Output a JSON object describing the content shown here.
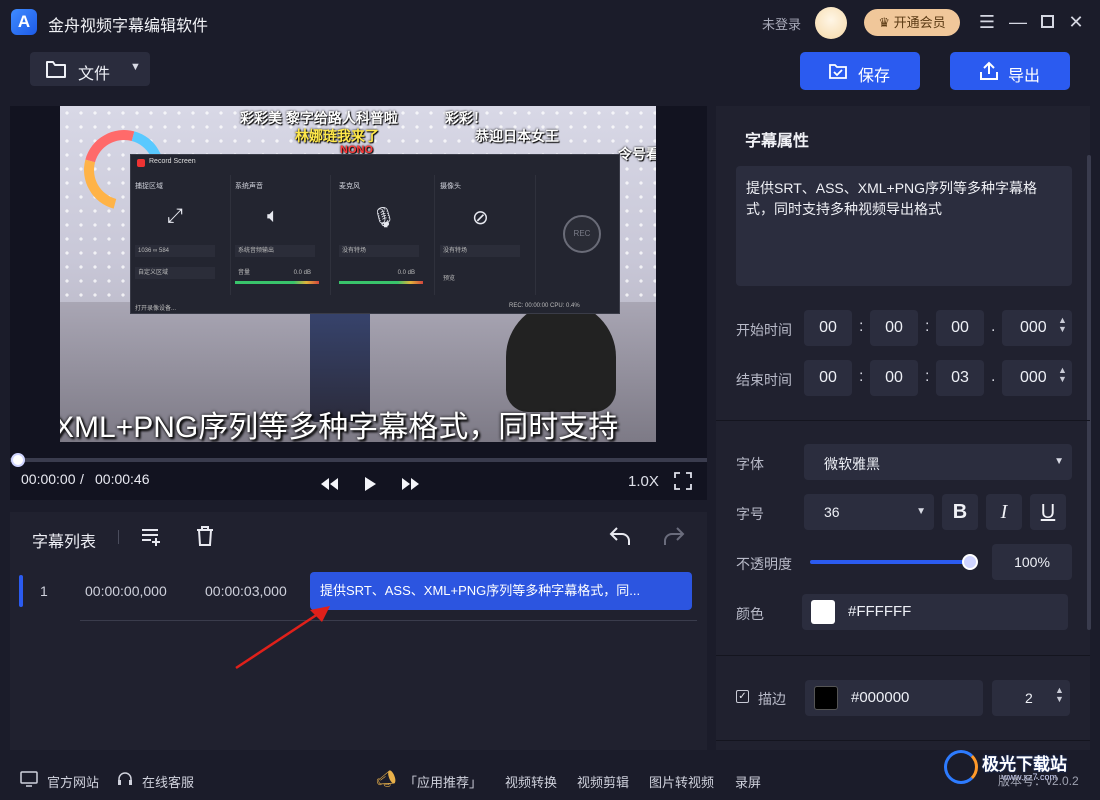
{
  "window": {
    "title": "金舟视频字幕编辑软件",
    "login_status": "未登录",
    "vip_button": "开通会员"
  },
  "toolbar": {
    "file_menu": "文件",
    "save": "保存",
    "export": "导出"
  },
  "video": {
    "danmaku": [
      "彩彩美",
      "黎字给路人科普啦",
      "彩彩！",
      "林娜琏我来了",
      "恭迎日本女王",
      "NONO",
      "令号"
    ],
    "danmaku_line1": "彩彩美 黎字给路人科普啦",
    "danmaku_line1b": "彩彩！",
    "danmaku_line2": "林娜琏我来了",
    "danmaku_line2b": "恭迎日本女王",
    "danmaku_line3": "NONO",
    "danmaku_line3b": "令号看",
    "subtitle_overlay": "XML+PNG序列等多种字幕格式，同时支持",
    "record_window": {
      "title": "Record Screen",
      "columns": [
        "捕捉区域",
        "系统声音",
        "麦克风",
        "摄像头"
      ],
      "capture_w": "1036",
      "capture_h": "584",
      "capture_mode": "自定义区域",
      "sys_audio_select": "系统音频输出",
      "mic_select": "没有特场",
      "cam_select": "没有特场",
      "volume_label": "音量",
      "db_1": "0.0 dB",
      "db_2": "0.0 dB",
      "preview_label": "预览",
      "rec_button": "REC",
      "footer_left": "打开录像设备...",
      "footer_right": "REC: 00:00:00    CPU: 0.4%"
    }
  },
  "playback": {
    "current_time": "00:00:00",
    "separator": "/",
    "total_time": "00:00:46",
    "progress": 0,
    "speed": "1.0X"
  },
  "subtitle_list": {
    "title": "字幕列表",
    "rows": [
      {
        "index": "1",
        "start": "00:00:00,000",
        "end": "00:00:03,000",
        "text": "提供SRT、ASS、XML+PNG序列等多种字幕格式，同..."
      }
    ]
  },
  "properties": {
    "title": "字幕属性",
    "text": "提供SRT、ASS、XML+PNG序列等多种字幕格式，同时支持多种视频导出格式",
    "start_label": "开始时间",
    "start": {
      "h": "00",
      "m": "00",
      "s": "00",
      "ms": "000"
    },
    "end_label": "结束时间",
    "end": {
      "h": "00",
      "m": "00",
      "s": "03",
      "ms": "000"
    },
    "colon": ":",
    "dot": ".",
    "font_label": "字体",
    "font_value": "微软雅黑",
    "size_label": "字号",
    "size_value": "36",
    "bold": "B",
    "italic": "I",
    "underline": "U",
    "opacity_label": "不透明度",
    "opacity_value": "100%",
    "opacity_fraction": 1.0,
    "color_label": "颜色",
    "color_value": "#FFFFFF",
    "stroke_label": "描边",
    "stroke_checked": true,
    "stroke_color": "#000000",
    "stroke_width": "2"
  },
  "footer": {
    "website": "官方网站",
    "support": "在线客服",
    "recommend": "「应用推荐」",
    "links": [
      "视频转换",
      "视频剪辑",
      "图片转视频",
      "录屏"
    ],
    "version": "版本号：v2.0.2"
  },
  "watermark": {
    "text": "极光下载站",
    "sub": "www.xz7.com"
  },
  "colors": {
    "accent": "#2b5bf0",
    "background": "#1b1c2a",
    "panel": "#20212f",
    "vip": "#f0c79a",
    "arrow": "#e0201a"
  },
  "icons": [
    "app-logo-icon",
    "folder-icon",
    "save-icon",
    "export-icon",
    "menu-icon",
    "minimize-icon",
    "maximize-icon",
    "close-icon",
    "rewind-icon",
    "play-icon",
    "forward-icon",
    "fullscreen-icon",
    "add-row-icon",
    "delete-icon",
    "undo-icon",
    "redo-icon",
    "monitor-icon",
    "headset-icon",
    "megaphone-icon"
  ]
}
